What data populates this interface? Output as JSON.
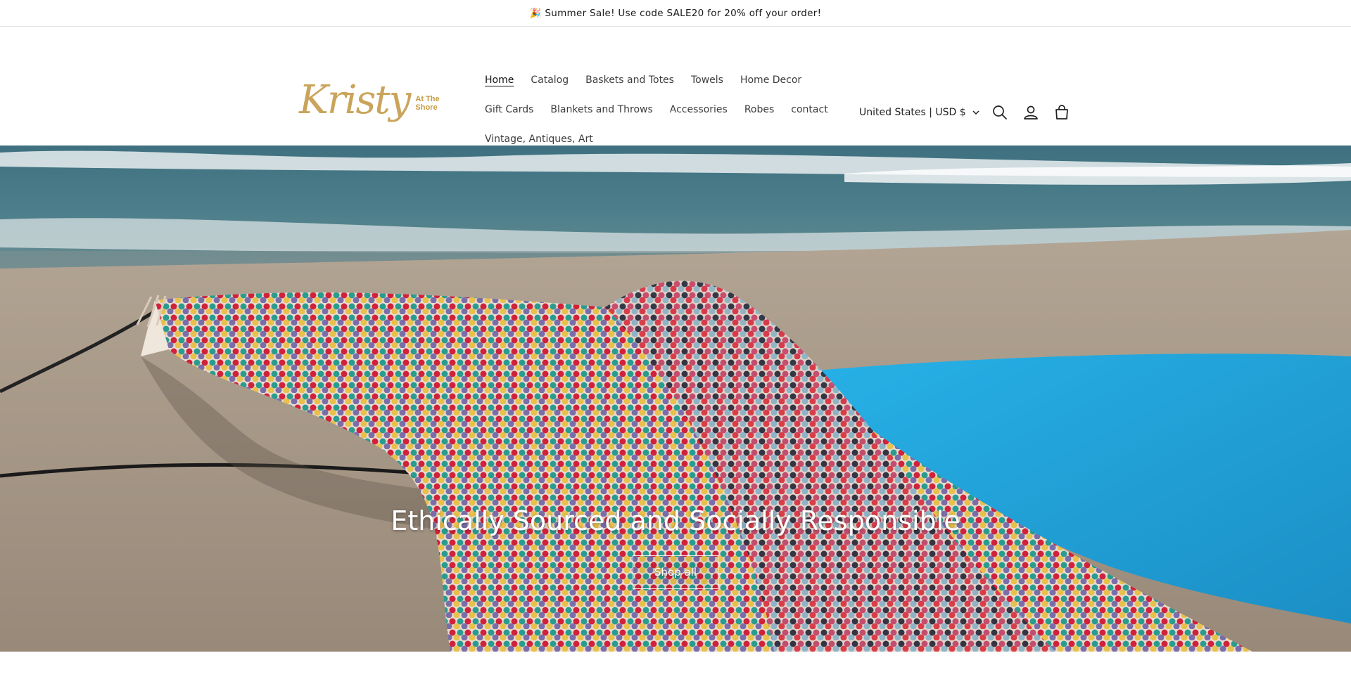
{
  "announcement": {
    "text": "🎉 Summer Sale! Use code SALE20 for 20% off your order!"
  },
  "logo": {
    "script": "Kristy",
    "tagline": "At The Shore"
  },
  "nav": {
    "items": [
      {
        "label": "Home",
        "active": true
      },
      {
        "label": "Catalog"
      },
      {
        "label": "Baskets and Totes"
      },
      {
        "label": "Towels"
      },
      {
        "label": "Home Decor"
      },
      {
        "label": "Gift Cards"
      },
      {
        "label": "Blankets and Throws"
      },
      {
        "label": "Accessories"
      },
      {
        "label": "Robes"
      },
      {
        "label": "contact"
      },
      {
        "label": "Vintage, Antiques, Art"
      }
    ]
  },
  "header_right": {
    "country_selector": "United States | USD $",
    "icons": [
      "search-icon",
      "account-icon",
      "cart-icon"
    ]
  },
  "hero": {
    "heading": "Ethically Sourced and Socially Responsible",
    "button_label": "Shop all"
  },
  "colors": {
    "logo_gold": "#c9a45a",
    "ocean": "#3c6f7c",
    "sand": "#b6a794",
    "surfboard": "#1ea6de"
  }
}
